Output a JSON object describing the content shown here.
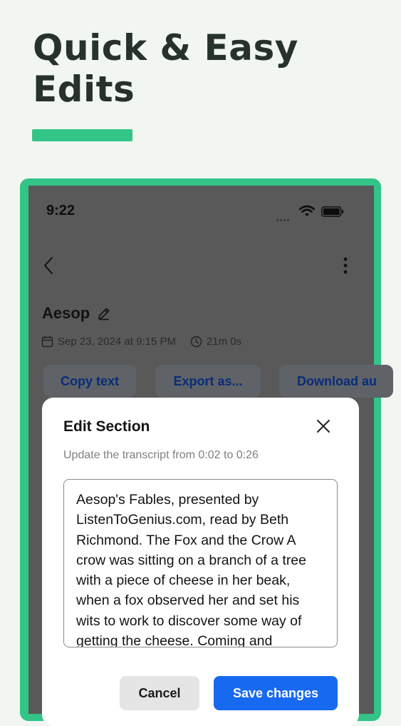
{
  "promo": {
    "headline_line1": "Quick & Easy",
    "headline_line2": "Edits",
    "accent_color": "#33c487"
  },
  "status_bar": {
    "time": "9:22"
  },
  "recording": {
    "title": "Aesop",
    "date": "Sep 23, 2024 at 9:15 PM",
    "duration": "21m 0s"
  },
  "actions": {
    "copy_label": "Copy text",
    "export_label": "Export as...",
    "download_label": "Download au"
  },
  "modal": {
    "title": "Edit Section",
    "subtitle": "Update the transcript from 0:02 to 0:26",
    "transcript": "Aesop's Fables, presented by ListenToGenius.com, read by Beth Richmond. The Fox and the Crow A crow was sitting on a branch of a tree with a piece of cheese in her beak, when a fox observed her and set his wits to work to discover some way of getting the cheese. Coming and",
    "cancel_label": "Cancel",
    "save_label": "Save changes",
    "save_color": "#1769f0"
  },
  "icons": {
    "back": "chevron-left-icon",
    "more": "vertical-dots-icon",
    "edit": "pencil-icon",
    "date": "calendar-icon",
    "duration": "clock-icon",
    "close": "close-icon",
    "wifi": "wifi-icon",
    "battery": "battery-icon"
  }
}
